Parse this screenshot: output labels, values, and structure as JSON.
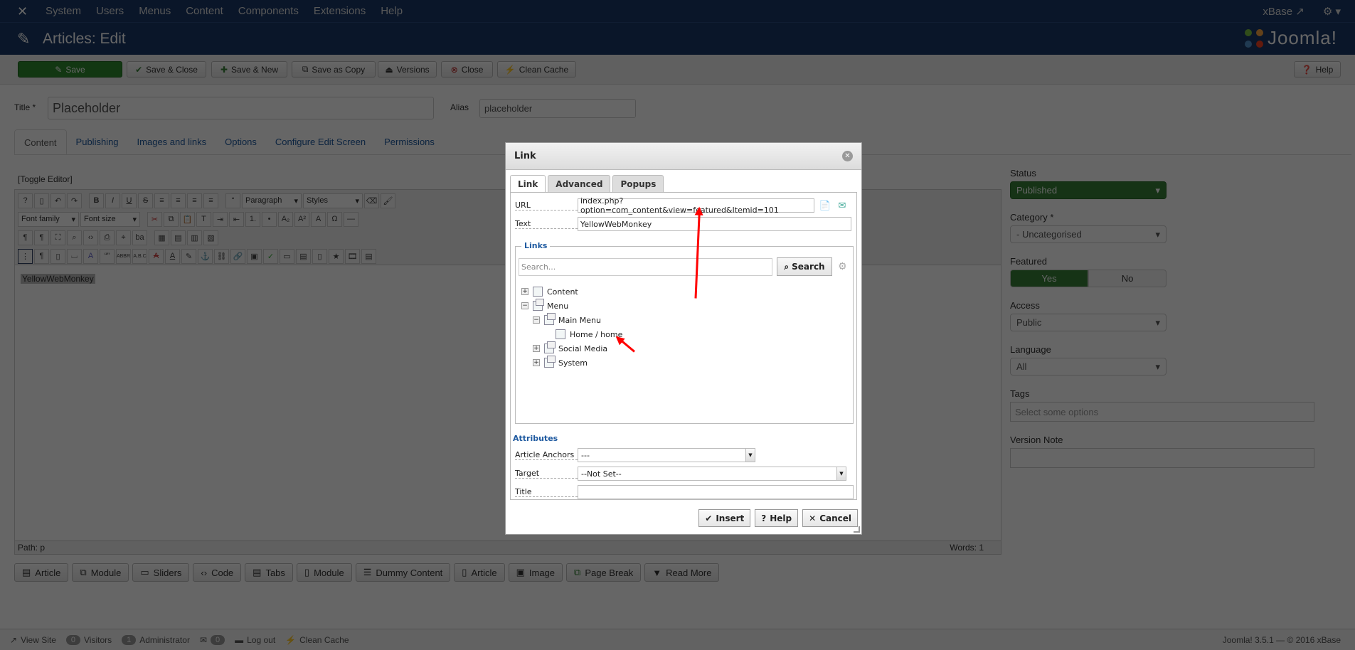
{
  "topnav": {
    "menu": [
      "System",
      "Users",
      "Menus",
      "Content",
      "Components",
      "Extensions",
      "Help"
    ],
    "site_link": "xBase",
    "icons": {
      "logo": "joomla-icon",
      "external": "external-link-icon",
      "settings": "gear-icon"
    }
  },
  "header": {
    "title": "Articles: Edit",
    "brand": "Joomla!"
  },
  "toolbar": {
    "save": "Save",
    "save_close": "Save & Close",
    "save_new": "Save & New",
    "save_copy": "Save as Copy",
    "versions": "Versions",
    "close": "Close",
    "clean_cache": "Clean Cache",
    "help": "Help"
  },
  "form": {
    "title_label": "Title *",
    "title_value": "Placeholder",
    "alias_label": "Alias",
    "alias_value": "placeholder"
  },
  "tabs": [
    "Content",
    "Publishing",
    "Images and links",
    "Options",
    "Configure Edit Screen",
    "Permissions"
  ],
  "editor": {
    "toggle": "[Toggle Editor]",
    "paragraph": "Paragraph",
    "styles": "Styles",
    "font_family": "Font family",
    "font_size": "Font size",
    "content": "YellowWebMonkey",
    "path": "Path:  p",
    "words": "Words: 1"
  },
  "extension_buttons": [
    "Article",
    "Module",
    "Sliders",
    "Code",
    "Tabs",
    "Module",
    "Dummy Content",
    "Article",
    "Image",
    "Page Break",
    "Read More"
  ],
  "sidebar": {
    "status_label": "Status",
    "status_value": "Published",
    "category_label": "Category *",
    "category_value": "- Uncategorised",
    "featured_label": "Featured",
    "featured_yes": "Yes",
    "featured_no": "No",
    "access_label": "Access",
    "access_value": "Public",
    "language_label": "Language",
    "language_value": "All",
    "tags_label": "Tags",
    "tags_placeholder": "Select some options",
    "version_note_label": "Version Note",
    "version_note_value": ""
  },
  "modal": {
    "title": "Link",
    "tabs": [
      "Link",
      "Advanced",
      "Popups"
    ],
    "url_label": "URL",
    "url_value": "index.php?option=com_content&view=featured&Itemid=101",
    "text_label": "Text",
    "text_value": "YellowWebMonkey",
    "links_legend": "Links",
    "search_placeholder": "Search...",
    "search_button": "Search",
    "tree": [
      {
        "label": "Content",
        "toggle": "+",
        "icon": "content"
      },
      {
        "label": "Menu",
        "toggle": "−",
        "icon": "menu"
      },
      {
        "label": "Main Menu",
        "toggle": "−",
        "icon": "menu"
      },
      {
        "label": "Home / home",
        "toggle": "",
        "icon": "page"
      },
      {
        "label": "Social Media",
        "toggle": "+",
        "icon": "menu"
      },
      {
        "label": "System",
        "toggle": "+",
        "icon": "menu"
      }
    ],
    "attributes_legend": "Attributes",
    "anchors_label": "Article Anchors",
    "anchors_value": "---",
    "target_label": "Target",
    "target_value": "--Not Set--",
    "title_label": "Title",
    "title_value": "",
    "insert": "Insert",
    "help": "Help",
    "cancel": "Cancel"
  },
  "footer": {
    "view_site": "View Site",
    "visitors_count": "0",
    "visitors": "Visitors",
    "admin_count": "1",
    "administrator": "Administrator",
    "messages_count": "0",
    "logout": "Log out",
    "clean_cache": "Clean Cache",
    "version": "Joomla! 3.5.1  —  © 2016 xBase"
  },
  "colors": {
    "nav": "#1a3867",
    "save_green": "#2f8a2f",
    "link_blue": "#1f5aa0",
    "annotation_red": "#ff0000"
  }
}
